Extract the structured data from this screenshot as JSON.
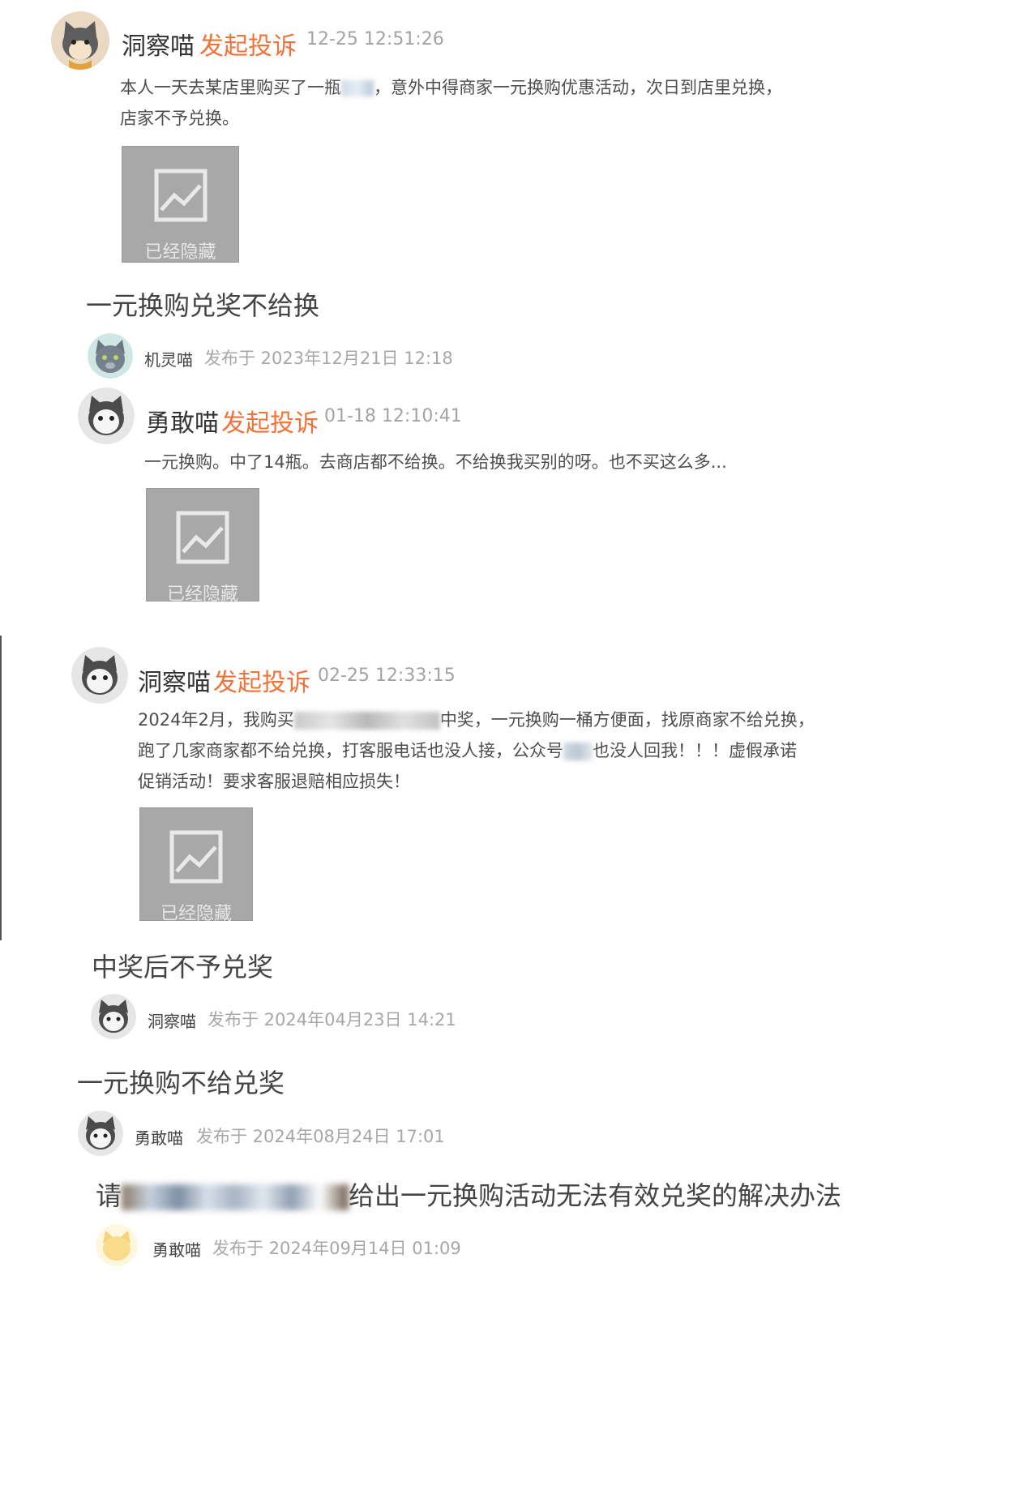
{
  "posts": [
    {
      "name": "洞察喵",
      "action": "发起投诉",
      "time": "12-25 12:51:26",
      "text_1": "本人一天去某店里购买了一瓶",
      "text_2": "，意外中得商家一元换购优惠活动，次日到店里兑换，",
      "text_3": "店家不予兑换。",
      "image_label": "已经隐藏",
      "avatar_icon": "cat-avatar-icon"
    },
    {
      "name": "勇敢喵",
      "action": "发起投诉",
      "time": "01-18 12:10:41",
      "text_1": "一元换购。中了14瓶。去商店都不给换。不给换我买别的呀。也不买这么多...",
      "image_label": "已经隐藏",
      "avatar_icon": "cat-avatar-icon"
    },
    {
      "name": "洞察喵",
      "action": "发起投诉",
      "time": "02-25 12:33:15",
      "text_1a": "2024年2月，我购买",
      "text_1b": "中奖，一元换购一桶方便面，找原商家不给兑换，",
      "text_2a": "跑了几家商家都不给兑换，打客服电话也没人接，公众号",
      "text_2b": "也没人回我！！！虚假承诺",
      "text_3": "促销活动！要求客服退赔相应损失！",
      "image_label": "已经隐藏",
      "avatar_icon": "cat-avatar-icon"
    }
  ],
  "threads": [
    {
      "title": "一元换购兑奖不给换",
      "author": "机灵喵",
      "meta": "发布于 2023年12月21日 12:18"
    },
    {
      "title": "中奖后不予兑奖",
      "author": "洞察喵",
      "meta": "发布于 2024年04月23日 14:21"
    },
    {
      "title": "一元换购不给兑奖",
      "author": "勇敢喵",
      "meta": "发布于 2024年08月24日 17:01"
    },
    {
      "title_a": "请",
      "title_b": "给出一元换购活动无法有效兑奖的解决办法",
      "author": "勇敢喵",
      "meta": "发布于 2024年09月14日 01:09"
    }
  ],
  "colors": {
    "accent": "#f0733a",
    "muted": "#a3a3a3",
    "placeholder_bg": "#a8a8a8"
  }
}
